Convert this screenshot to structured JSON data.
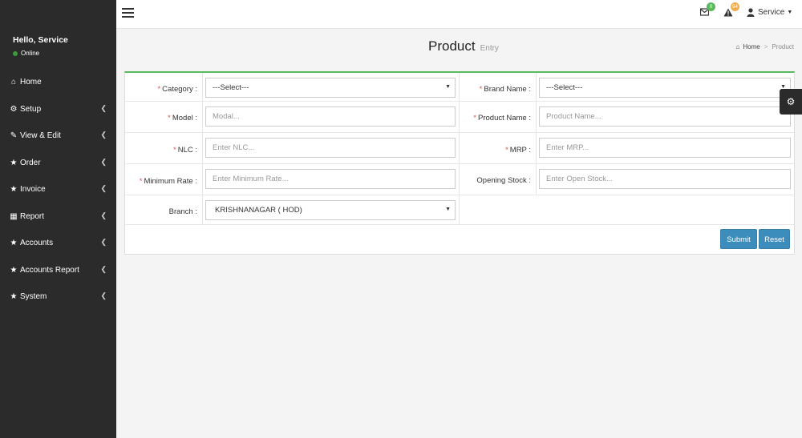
{
  "sidebar": {
    "user_name": "Hello, Service",
    "user_status": "Online",
    "items": [
      {
        "label": "Home",
        "icon": "home-icon",
        "has_children": false
      },
      {
        "label": "Setup",
        "icon": "cogs-icon",
        "has_children": true
      },
      {
        "label": "View & Edit",
        "icon": "edit-icon",
        "has_children": true
      },
      {
        "label": "Order",
        "icon": "star-icon",
        "has_children": true
      },
      {
        "label": "Invoice",
        "icon": "star-icon",
        "has_children": true
      },
      {
        "label": "Report",
        "icon": "file-icon",
        "has_children": true
      },
      {
        "label": "Accounts",
        "icon": "star-icon",
        "has_children": true
      },
      {
        "label": "Accounts Report",
        "icon": "star-icon",
        "has_children": true
      },
      {
        "label": "System",
        "icon": "star-icon",
        "has_children": true
      }
    ]
  },
  "topbar": {
    "mail_badge": "0",
    "alert_badge": "94",
    "user_label": "Service"
  },
  "header": {
    "title": "Product",
    "subtitle": "Entry",
    "breadcrumb_home": "Home",
    "breadcrumb_current": "Product"
  },
  "form": {
    "category_label": "Category :",
    "category_value": "---Select---",
    "brand_label": "Brand Name :",
    "brand_value": "---Select---",
    "model_label": "Model :",
    "model_placeholder": "Modal...",
    "product_name_label": "Product Name :",
    "product_name_placeholder": "Product Name...",
    "nlc_label": "NLC :",
    "nlc_placeholder": "Enter NLC...",
    "mrp_label": "MRP :",
    "mrp_placeholder": "Enter MRP...",
    "min_rate_label": "Minimum Rate :",
    "min_rate_placeholder": "Enter Minimum Rate...",
    "opening_stock_label": "Opening Stock :",
    "opening_stock_placeholder": "Enter Open Stock...",
    "branch_label": "Branch :",
    "branch_value": "KRISHNANAGAR ( HOD)",
    "required_mark": "*",
    "submit_label": "Submit",
    "reset_label": "Reset"
  },
  "colors": {
    "sidebar_bg": "#2b2b2b",
    "accent": "#3c8dbc",
    "box_top_border": "#5cb85c",
    "required": "#d9534f"
  }
}
